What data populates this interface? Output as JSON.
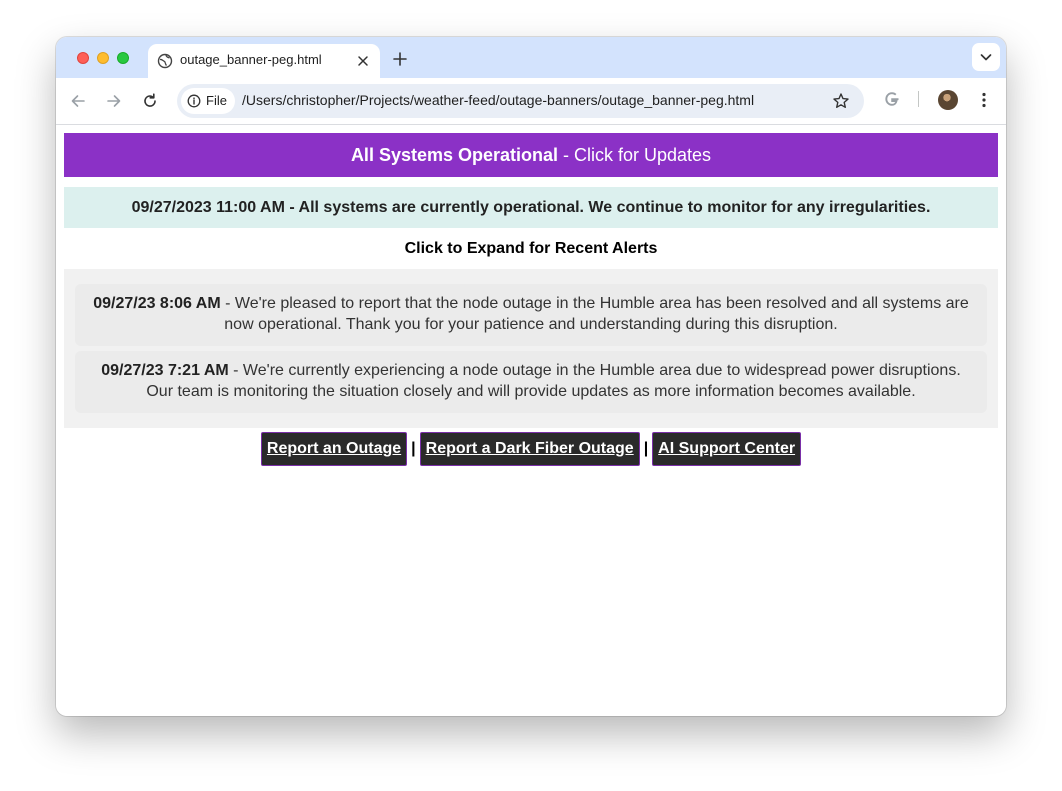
{
  "browser": {
    "tab_title": "outage_banner-peg.html",
    "chip_label": "File",
    "url": "/Users/christopher/Projects/weather-feed/outage-banners/outage_banner-peg.html"
  },
  "page": {
    "banner_strong": "All Systems Operational",
    "banner_rest": " - Click for Updates",
    "status_message": "09/27/2023 11:00 AM - All systems are currently operational. We continue to monitor for any irregularities.",
    "expand_label": "Click to Expand for Recent Alerts",
    "alerts": [
      {
        "time": "09/27/23 8:06 AM",
        "text": " - We're pleased to report that the node outage in the Humble area has been resolved and all systems are now operational. Thank you for your patience and understanding during this disruption."
      },
      {
        "time": "09/27/23 7:21 AM",
        "text": " - We're currently experiencing a node outage in the Humble area due to widespread power disruptions. Our team is monitoring the situation closely and will provide updates as more information becomes available."
      }
    ],
    "links": {
      "report_outage": "Report an Outage",
      "separator": "|",
      "report_dark_fiber": "Report a Dark Fiber Outage",
      "support_center": "AI Support Center"
    }
  },
  "colors": {
    "banner": "#8b31c6",
    "status_bar": "#dcf0ee",
    "link_button": "#2a2a2a"
  }
}
